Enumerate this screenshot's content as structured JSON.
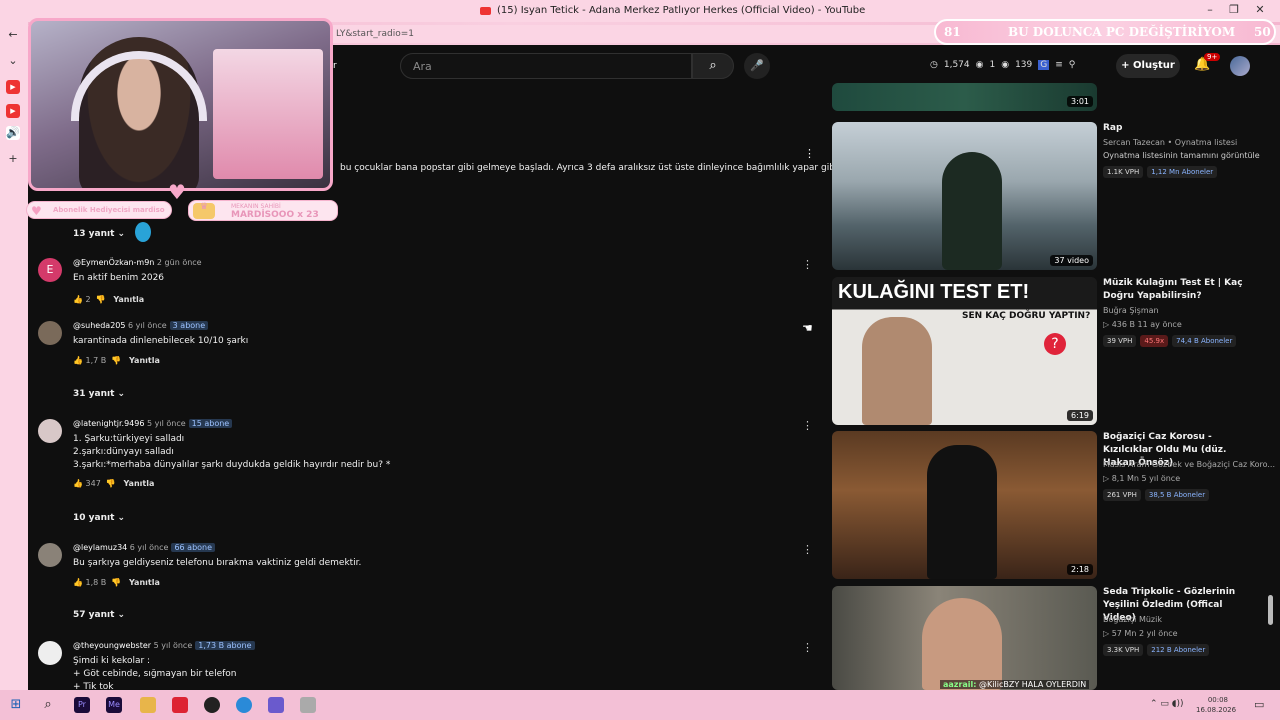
{
  "window": {
    "title": "(15) Isyan Tetick - Adana Merkez Patlıyor Herkes (Official Video) - YouTube",
    "minimize": "–",
    "maximize": "❐",
    "close": "✕"
  },
  "browser": {
    "url": "LY&start_radio=1"
  },
  "header": {
    "search_placeholder": "Ara",
    "stats": [
      "1,574",
      "1",
      "139"
    ],
    "create_label": "Oluştur",
    "notif_badge": "9+",
    "partial_label": "r"
  },
  "top_comment": {
    "text": "bu çocuklar bana popstar gibi gelmeye başladı. Ayrıca 3 defa aralıksız üst üste dinleyince bağımlılık yapar gibi oldu."
  },
  "comments": [
    {
      "replies": "13 yanıt"
    },
    {
      "avatar_letter": "E",
      "author": "@EymenÖzkan-m9n",
      "time": "2 gün önce",
      "subs": "",
      "lines": [
        "En aktif benim 2026"
      ],
      "likes": "2",
      "reply": "Yanıtla",
      "replies": ""
    },
    {
      "author": "@suheda205",
      "time": "6 yıl önce",
      "subs": "3 abone",
      "lines": [
        "karantinada dinlenebilecek 10/10 şarkı"
      ],
      "likes": "1,7 B",
      "reply": "Yanıtla",
      "replies": "31 yanıt"
    },
    {
      "author": "@latenightjr.9496",
      "time": "5 yıl önce",
      "subs": "15 abone",
      "lines": [
        "1. Şarku:türkiyeyi salladı",
        "2.şarkı:dünyayı salladı",
        "3.şarkı:*merhaba dünyalılar şarkı duydukda geldik hayırdır nedir bu? *"
      ],
      "likes": "347",
      "reply": "Yanıtla",
      "replies": "10 yanıt"
    },
    {
      "author": "@leylamuz34",
      "time": "6 yıl önce",
      "subs": "66 abone",
      "lines": [
        "Bu şarkıya geldiyseniz telefonu bırakma vaktiniz geldi demektir."
      ],
      "likes": "1,8 B",
      "reply": "Yanıtla",
      "replies": "57 yanıt"
    },
    {
      "author": "@theyoungwebster",
      "time": "5 yıl önce",
      "subs": "1,73 B abone",
      "lines": [
        "Şimdi ki kekolar :",
        "+ Göt cebinde, sığmayan bir telefon",
        "+ Tik tok"
      ]
    }
  ],
  "related": [
    {
      "duration": "3:01"
    },
    {
      "title": "Rap",
      "channel": "Sercan Tazecan • Oynatma listesi",
      "info": "Oynatma listesinin tamamını görüntüle",
      "duration": "37 video",
      "vph": "1.1K VPH",
      "extra": "",
      "subs": "1,12 Mn Aboneler"
    },
    {
      "title": "Müzik Kulağını Test Et | Kaç Doğru Yapabilirsin?",
      "channel": "Buğra Şişman",
      "info": "436 B  11 ay önce",
      "duration": "6:19",
      "vph": "39 VPH",
      "extra": "45.9x",
      "subs": "74,4 B Aboneler",
      "thumb_text": "KULAĞINI TEST ET!",
      "thumb_sub": "SEN KAÇ DOĞRU YAPTIN?"
    },
    {
      "title": "Boğaziçi Caz Korosu - Kızılcıklar Oldu Mu (düz. Hakan Önsöz)",
      "channel": "Masis Aram Gözbek ve Boğaziçi Caz Koro...",
      "info": "8,1 Mn  5 yıl önce",
      "duration": "2:18",
      "vph": "261 VPH",
      "extra": "",
      "subs": "38,5 B Aboneler"
    },
    {
      "title": "Seda Tripkolic - Gözlerinin Yeşilini Özledim (Offical Video)",
      "channel": "Boğaziçi Müzik",
      "info": "57 Mn  2 yıl önce",
      "duration": "",
      "vph": "3.3K VPH",
      "extra": "",
      "subs": "212 B Aboneler"
    }
  ],
  "overlay": {
    "goal_left": "81",
    "goal_text": "BU DOLUNCA PC DEĞİŞTİRİYOM",
    "goal_right": "50",
    "sub_gift": "Abonelik Hediyecisi mardiso",
    "mekan_label": "MEKANIN SAHİBİ",
    "mekan_name": "MARDİSOOO x 23",
    "chat_user": "aazrail:",
    "chat_msg": "@KilicBZY HALA OYLERDIN"
  },
  "taskbar": {
    "time": "00:08",
    "date": "16.08.2026",
    "apps": [
      "Pr",
      "Me"
    ]
  }
}
